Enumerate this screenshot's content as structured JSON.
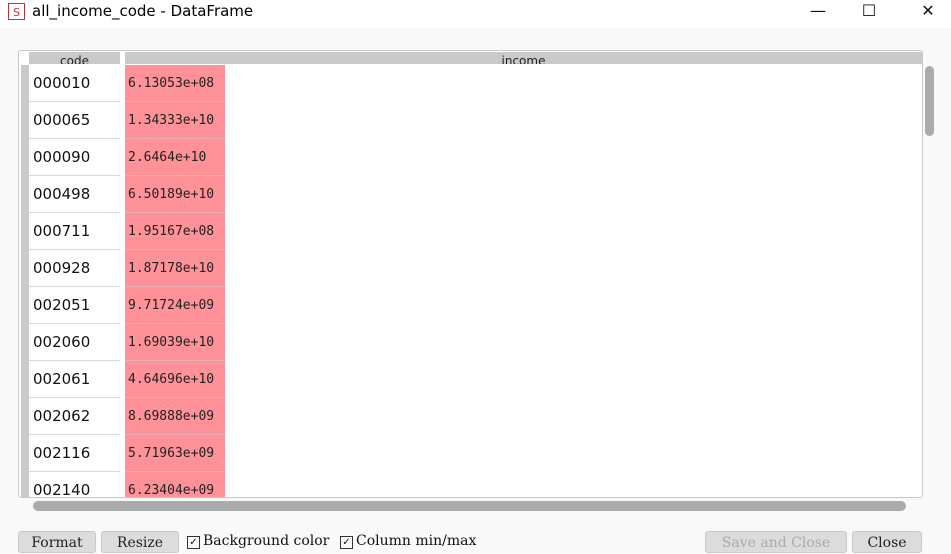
{
  "window": {
    "title": "all_income_code - DataFrame",
    "icon": "spyder-icon"
  },
  "table": {
    "columns": [
      "code",
      "income"
    ],
    "rows": [
      {
        "code": "000010",
        "income": "6.13053e+08"
      },
      {
        "code": "000065",
        "income": "1.34333e+10"
      },
      {
        "code": "000090",
        "income": "2.6464e+10"
      },
      {
        "code": "000498",
        "income": "6.50189e+10"
      },
      {
        "code": "000711",
        "income": "1.95167e+08"
      },
      {
        "code": "000928",
        "income": "1.87178e+10"
      },
      {
        "code": "002051",
        "income": "9.71724e+09"
      },
      {
        "code": "002060",
        "income": "1.69039e+10"
      },
      {
        "code": "002061",
        "income": "4.64696e+10"
      },
      {
        "code": "002062",
        "income": "8.69888e+09"
      },
      {
        "code": "002116",
        "income": "5.71963e+09"
      },
      {
        "code": "002140",
        "income": "6.23404e+09"
      }
    ],
    "cell_color": "#ff9299"
  },
  "footer": {
    "format": "Format",
    "resize": "Resize",
    "background_color": "Background color",
    "background_color_checked": true,
    "column_minmax": "Column min/max",
    "column_minmax_checked": true,
    "save_close": "Save and Close",
    "close": "Close"
  }
}
